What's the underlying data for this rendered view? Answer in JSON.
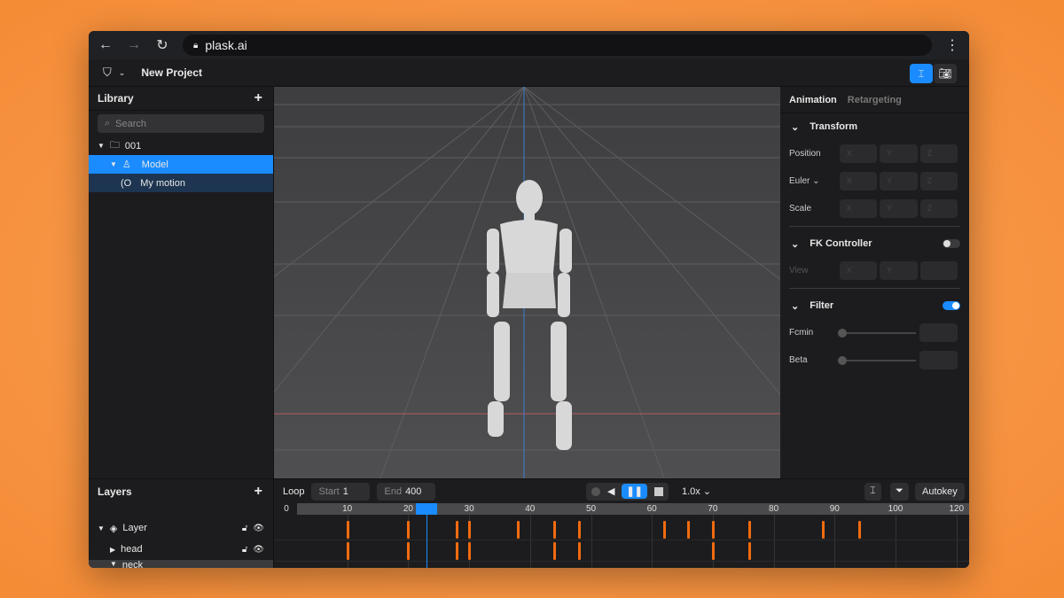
{
  "browser": {
    "url": "plask.ai"
  },
  "app": {
    "project_title": "New Project",
    "accent": "#1a8cff",
    "keyframe_color": "#f26b10"
  },
  "library": {
    "title": "Library",
    "search_placeholder": "Search",
    "items": [
      {
        "label": "001",
        "icon": "folder-icon"
      },
      {
        "label": "Model",
        "icon": "person-icon",
        "selected": true
      },
      {
        "label": "My motion",
        "icon": "motion-icon"
      }
    ]
  },
  "panel": {
    "tabs": [
      "Animation",
      "Retargeting"
    ],
    "active_tab": "Animation",
    "transform": {
      "title": "Transform",
      "rows": [
        {
          "label": "Position"
        },
        {
          "label": "Euler"
        },
        {
          "label": "Scale"
        }
      ],
      "axes": [
        "X",
        "Y",
        "Z"
      ]
    },
    "fk": {
      "title": "FK Controller",
      "enabled": false,
      "view_label": "View",
      "axes": [
        "X",
        "Y"
      ]
    },
    "filter": {
      "title": "Filter",
      "enabled": true,
      "rows": [
        {
          "label": "Fcmin",
          "value": 0
        },
        {
          "label": "Beta",
          "value": 0
        }
      ]
    }
  },
  "layers": {
    "title": "Layers",
    "items": [
      {
        "label": "Layer"
      },
      {
        "label": "head"
      },
      {
        "label": "neck"
      }
    ]
  },
  "timeline": {
    "loop_label": "Loop",
    "start_label": "Start",
    "start": "1",
    "end_label": "End",
    "end": "400",
    "speed": "1.0x",
    "autokey": "Autokey",
    "current_frame": 23,
    "ticks": [
      "0",
      "10",
      "20",
      "30",
      "40",
      "50",
      "60",
      "70",
      "80",
      "90",
      "100",
      "120"
    ],
    "tracks": [
      [
        10,
        20,
        28,
        30,
        38,
        44,
        48,
        62,
        66,
        70,
        76,
        88,
        94
      ],
      [
        10,
        20,
        28,
        30,
        44,
        48,
        70,
        76
      ]
    ]
  }
}
